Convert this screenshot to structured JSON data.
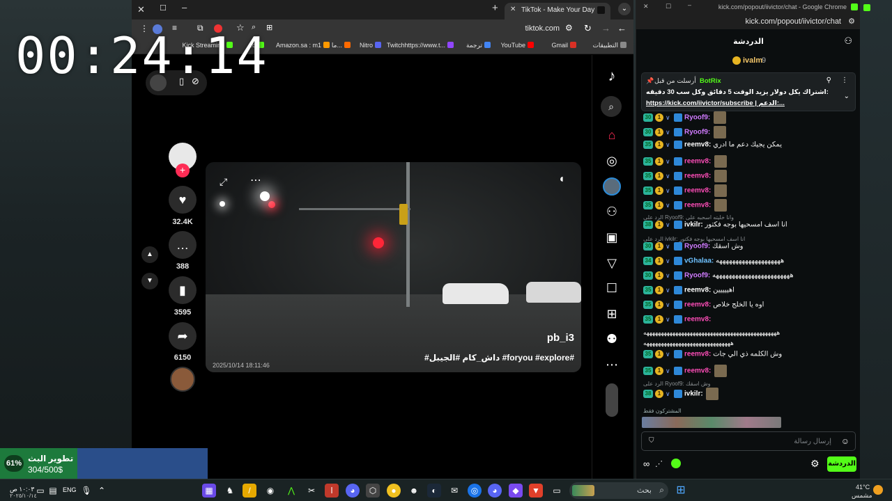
{
  "overlay": {
    "timer": "00:24:14",
    "goal": {
      "percent_label": "61%",
      "progress": 0.61,
      "title": "تطوير البث",
      "amount": "304/500$"
    }
  },
  "main_window": {
    "tab": {
      "title": "TikTok - Make Your Day"
    },
    "url": "tiktok.com",
    "bookmarks": [
      {
        "label": "التطبيقات",
        "color": "#8a8a8a"
      },
      {
        "label": "Gmail",
        "color": "#d93025"
      },
      {
        "label": "YouTube",
        "color": "#ff0000"
      },
      {
        "label": "ترجمة",
        "color": "#4285f4"
      },
      {
        "label": "Twitchhttps://www.t...",
        "color": "#9146ff"
      },
      {
        "label": "Nitro",
        "color": "#5865f2"
      },
      {
        "label": "ما...",
        "color": "#ff6a00"
      },
      {
        "label": "Amazon.sa : m1",
        "color": "#ff9900"
      },
      {
        "label": "...d",
        "color": "#53fc18"
      },
      {
        "label": "Kick Streaming",
        "color": "#53fc18"
      }
    ]
  },
  "tiktok": {
    "counts": {
      "likes": "32.4K",
      "comments": "388",
      "saves": "3595",
      "shares": "6150"
    },
    "video": {
      "username": "pb_i3",
      "caption": "#داش_كام #الجيبل #foryou #explore#",
      "timestamp": "2025/10/14   18:11:46"
    }
  },
  "chat_window": {
    "window_title": "kick.com/popout/iivictor/chat - Google Chrome",
    "url": "kick.com/popout/iivictor/chat",
    "header_title": "الدردشة",
    "viewer": {
      "name": "ivalm",
      "count": "9"
    },
    "pinned": {
      "pinned_by": "أرسلت من قبل",
      "author": "BotRix",
      "text": "اشتراك يكل دولار يزيد الوقت 5 دقائق وكل سب 30 دقيقه:",
      "link": "https://kick.com/iivictor/subscribe | الدعم:..."
    },
    "messages": [
      {
        "sub": "30",
        "user": "Ryoof9:",
        "user_color": "#d07bff",
        "text": "",
        "emote": true
      },
      {
        "sub": "30",
        "user": "Ryoof9:",
        "user_color": "#d07bff",
        "text": "",
        "emote": true
      },
      {
        "sub": "35",
        "user": "reemv8:",
        "user_color": "#ffffff",
        "text": "يمكن يجيك دعم ما ادري",
        "emote": false
      },
      {
        "sub": "35",
        "user": "reemv8:",
        "user_color": "#ff4db8",
        "text": "",
        "emote": true
      },
      {
        "sub": "35",
        "user": "reemv8:",
        "user_color": "#ff4db8",
        "text": "",
        "emote": true
      },
      {
        "sub": "35",
        "user": "reemv8:",
        "user_color": "#ff4db8",
        "text": "",
        "emote": true
      },
      {
        "sub": "35",
        "user": "reemv8:",
        "user_color": "#ff4db8",
        "text": "",
        "emote": true
      },
      {
        "sub": "38",
        "user": "ivkilr:",
        "user_color": "#ffffff",
        "text": "انا اسف امسحيها بوجه فكتور",
        "emote": false
      },
      {
        "sub": "30",
        "user": "Ryoof9:",
        "user_color": "#d07bff",
        "text": "وش اسقك",
        "emote": false
      },
      {
        "sub": "34",
        "user": "vGhalaa:",
        "user_color": "#6ec1ff",
        "text": "ههههههههههههههههههههه",
        "emote": false
      },
      {
        "sub": "30",
        "user": "Ryoof9:",
        "user_color": "#d07bff",
        "text": "ههههههههههههههههههههههههه",
        "emote": false
      },
      {
        "sub": "35",
        "user": "reemv8:",
        "user_color": "#ffffff",
        "text": "اهييييين",
        "emote": false
      },
      {
        "sub": "35",
        "user": "reemv8:",
        "user_color": "#ff4db8",
        "text": "اوه يا الخلج خلاص",
        "emote": false
      },
      {
        "sub": "35",
        "user": "reemv8:",
        "user_color": "#ff4db8",
        "text": "",
        "emote": false
      },
      {
        "sub": "35",
        "user": "reemv8:",
        "user_color": "#ff4db8",
        "text": "وش الكلمه ذي الي جات",
        "emote": false
      },
      {
        "sub": "35",
        "user": "reemv8:",
        "user_color": "#ff4db8",
        "text": "",
        "emote": true
      },
      {
        "sub": "38",
        "user": "ivkilr:",
        "user_color": "#ffffff",
        "text": "",
        "emote": true
      }
    ],
    "reply_lines": [
      "الرد على Ryoof9: وانا خليته اسحبه على",
      "الرد على ivkilr: انا اسف امسحيها بوجه فكتور",
      "الرد على Ryoof9: وش اسقك"
    ],
    "long_line_1": "ههههههههههههههههههههههههههههههههههههههههههههههه",
    "long_line_2": "ههههههههههههههههههههههههههههههه",
    "subscribers_label": "المشتركون فقط",
    "input_placeholder": "إرسال رسالة",
    "send_label": "الدردشة"
  },
  "taskbar": {
    "search_label": "بحث",
    "language": "ENG",
    "time": "١٠:٠٣ ص",
    "date": "٢٠٢٥/١٠/١٤",
    "weather_temp": "41°C",
    "weather_desc": "مشمس"
  }
}
